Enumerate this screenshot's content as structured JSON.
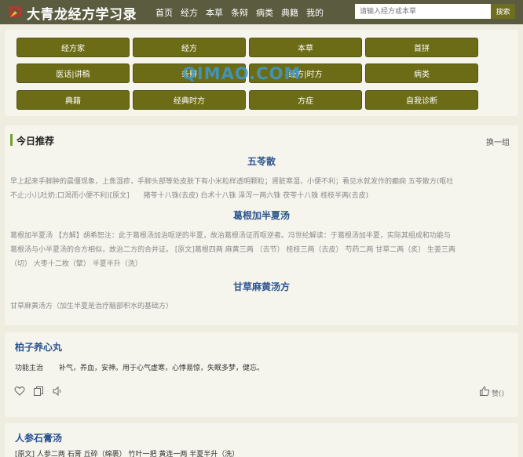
{
  "header": {
    "site_title": "大青龙经方学习录",
    "nav": [
      "首页",
      "经方",
      "本草",
      "条辩",
      "病类",
      "典籍",
      "我的"
    ],
    "search": {
      "placeholder": "请输入经方或本草",
      "button_label": "搜索"
    }
  },
  "categories": [
    "经方家",
    "经方",
    "本草",
    "首拼",
    "医话|讲稿",
    "条辩",
    "经方|时方",
    "病类",
    "典籍",
    "经典时方",
    "方症",
    "自我诊断"
  ],
  "watermark": "QIMAO.COM",
  "today": {
    "title": "今日推荐",
    "refresh_label": "换一组",
    "items": [
      {
        "name": "五苓散",
        "line1": "早上起来手脚肿的晨僵现象，上焦湿疹，手脚头部等处皮肤下有小米粒样透明颗粒；肾脏寒湿，小便不利；看见水就发作的癫痫 五苓散方(呕吐",
        "line2": "不止;小儿吐奶;口渴而小便不利)[原文]　　猪苓十八铢(去皮) 白术十八铢 泽泻一两六铢 茯苓十八铢 桂枝半两(去皮)"
      },
      {
        "name": "葛根加半夏汤",
        "line1": "葛根加半夏汤 【方解】胡希恕注：此于葛根汤加治呕逆的半夏，故治葛根汤证而呕逆者。冯世纶解读：于葛根汤加半夏，实际其组成和功能与",
        "line2": "葛根汤与小半夏汤的合方相似，故治二方的合并证。 [原文]葛根四两 麻黄三两 （去节） 桂枝三两（去皮） 芍药二两 甘草二两（炙） 生姜三两",
        "line3": "（切） 大枣十二枚（擘） 半夏半升（洗）"
      },
      {
        "name": "甘草麻黄汤方",
        "line1": "甘草麻黄汤方（加生半夏是治疗脑部积水的基础方）"
      }
    ]
  },
  "cards": [
    {
      "title": "柏子养心丸",
      "label": "功能主治",
      "text": "补气，养血，安神。用于心气虚寒，心悸易惊，失眠多梦，健忘。",
      "like_label": "赞()"
    },
    {
      "title": "人参石膏汤",
      "text": "[原文] 人参二两 石膏 丘碎（绵裹） 竹叶一把 黄连一两 半夏半升（洗）"
    }
  ]
}
